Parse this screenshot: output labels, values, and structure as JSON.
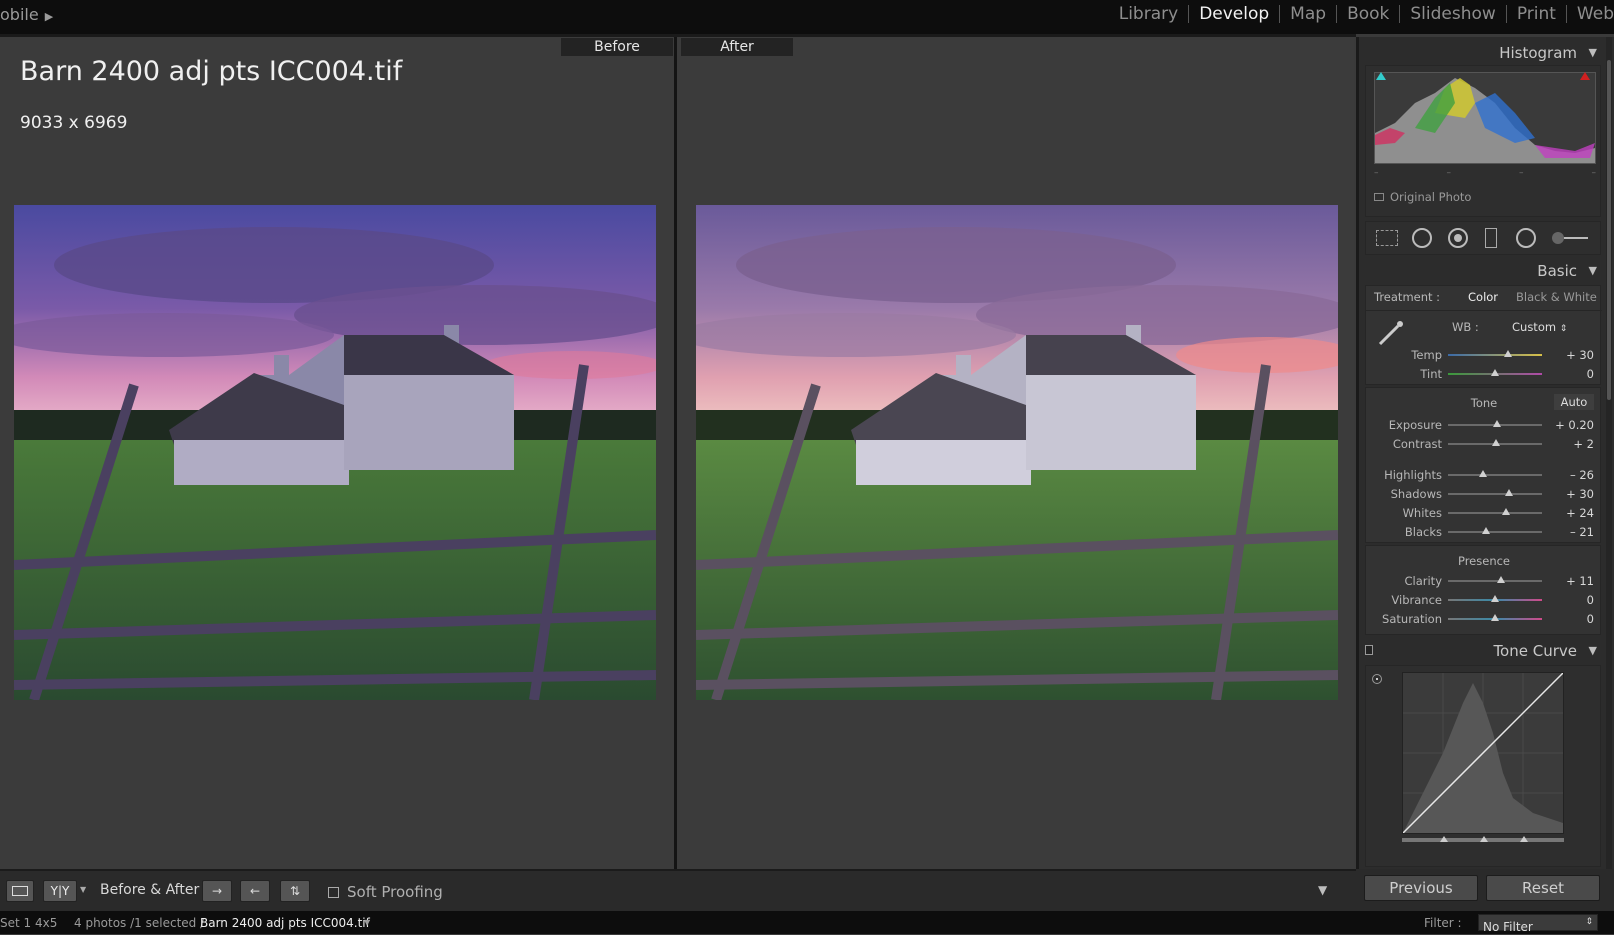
{
  "topbar": {
    "identity_text": "obile",
    "modules": [
      "Library",
      "Develop",
      "Map",
      "Book",
      "Slideshow",
      "Print",
      "Web"
    ],
    "active_module": "Develop"
  },
  "view": {
    "before_label": "Before",
    "after_label": "After",
    "file_name": "Barn 2400 adj pts ICC004.tif",
    "dimensions": "9033 x 6969"
  },
  "histogram": {
    "title": "Histogram",
    "original_photo_label": "Original Photo",
    "ticks": [
      "–",
      "–",
      "–",
      "–"
    ]
  },
  "basic": {
    "title": "Basic",
    "treatment_label": "Treatment :",
    "treatment_color": "Color",
    "treatment_bw": "Black & White",
    "wb_label": "WB :",
    "wb_value": "Custom",
    "wb_sliders": [
      {
        "label": "Temp",
        "value": "+ 30",
        "pos": 0.64
      },
      {
        "label": "Tint",
        "value": "0",
        "pos": 0.5
      }
    ],
    "tone_label": "Tone",
    "auto_label": "Auto",
    "tone_sliders": [
      {
        "label": "Exposure",
        "value": "+ 0.20",
        "pos": 0.52
      },
      {
        "label": "Contrast",
        "value": "+ 2",
        "pos": 0.51
      }
    ],
    "detail_sliders": [
      {
        "label": "Highlights",
        "value": "– 26",
        "pos": 0.37
      },
      {
        "label": "Shadows",
        "value": "+ 30",
        "pos": 0.65
      },
      {
        "label": "Whites",
        "value": "+ 24",
        "pos": 0.62
      },
      {
        "label": "Blacks",
        "value": "– 21",
        "pos": 0.4
      }
    ],
    "presence_label": "Presence",
    "presence_sliders": [
      {
        "label": "Clarity",
        "value": "+ 11",
        "pos": 0.56
      },
      {
        "label": "Vibrance",
        "value": "0",
        "pos": 0.5
      },
      {
        "label": "Saturation",
        "value": "0",
        "pos": 0.5
      }
    ]
  },
  "tone_curve": {
    "title": "Tone Curve"
  },
  "toolbar": {
    "before_after_label": "Before & After :",
    "soft_proofing_label": "Soft Proofing",
    "yy_label": "Y|Y"
  },
  "buttons": {
    "previous": "Previous",
    "reset": "Reset"
  },
  "filmstrip": {
    "set": "Set 1 4x5",
    "count": "4 photos /1 selected /",
    "file": "Barn 2400 adj pts ICC004.tif",
    "filter_label": "Filter :",
    "filter_value": "No Filter"
  }
}
